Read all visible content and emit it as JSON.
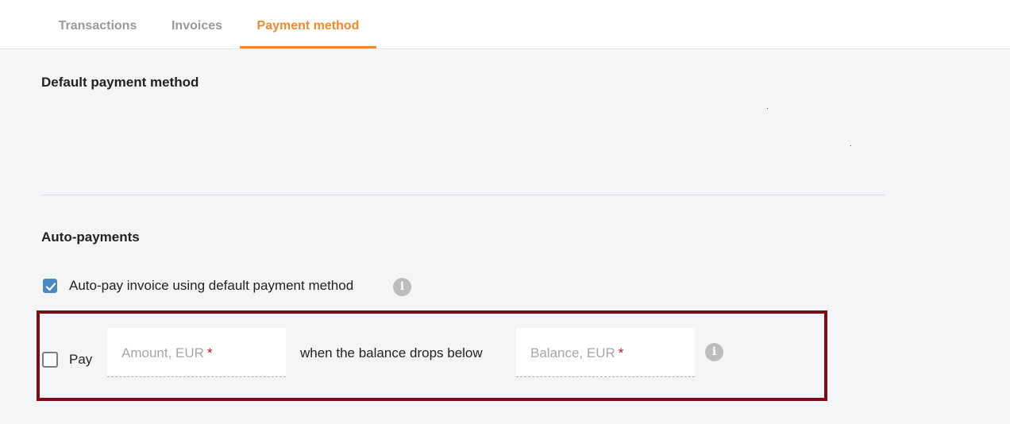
{
  "tabs": [
    {
      "label": "Transactions"
    },
    {
      "label": "Invoices"
    },
    {
      "label": "Payment method"
    }
  ],
  "active_tab": "Payment method",
  "default_payment": {
    "title": "Default payment method"
  },
  "auto_payments": {
    "title": "Auto-payments",
    "autopay_invoice": {
      "label": "Auto-pay invoice using default payment method",
      "checked": true
    },
    "threshold_rule": {
      "checked": false,
      "pay_label": "Pay",
      "amount_placeholder": "Amount, EUR",
      "middle_text": "when the balance drops below",
      "balance_placeholder": "Balance, EUR",
      "required_mark": "*"
    }
  },
  "colors": {
    "accent": "#f18a2b",
    "checkbox": "#4a88c4",
    "highlight_border": "#7a0a1c",
    "required": "#b0151f"
  },
  "icons": [
    "checkmark-icon",
    "info-icon"
  ]
}
